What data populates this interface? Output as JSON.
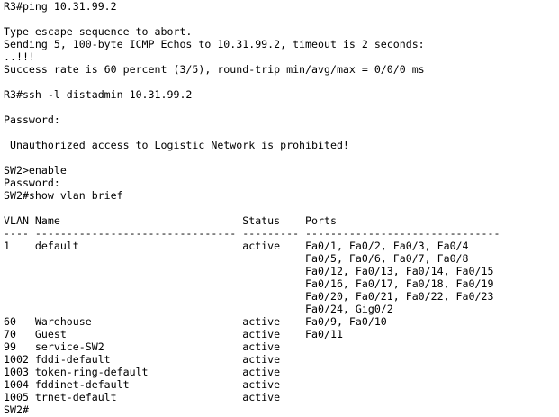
{
  "terminal": {
    "lines": [
      "R3#ping 10.31.99.2",
      "",
      "Type escape sequence to abort.",
      "Sending 5, 100-byte ICMP Echos to 10.31.99.2, timeout is 2 seconds:",
      "..!!!",
      "Success rate is 60 percent (3/5), round-trip min/avg/max = 0/0/0 ms",
      "",
      "R3#ssh -l distadmin 10.31.99.2",
      "",
      "Password:",
      "",
      " Unauthorized access to Logistic Network is prohibited!",
      "",
      "SW2>enable",
      "Password:",
      "SW2#show vlan brief",
      "",
      "VLAN Name                             Status    Ports",
      "---- -------------------------------- --------- -------------------------------",
      "1    default                          active    Fa0/1, Fa0/2, Fa0/3, Fa0/4",
      "                                                Fa0/5, Fa0/6, Fa0/7, Fa0/8",
      "                                                Fa0/12, Fa0/13, Fa0/14, Fa0/15",
      "                                                Fa0/16, Fa0/17, Fa0/18, Fa0/19",
      "                                                Fa0/20, Fa0/21, Fa0/22, Fa0/23",
      "                                                Fa0/24, Gig0/2",
      "60   Warehouse                        active    Fa0/9, Fa0/10",
      "70   Guest                            active    Fa0/11",
      "99   service-SW2                      active",
      "1002 fddi-default                     active",
      "1003 token-ring-default               active",
      "1004 fddinet-default                  active",
      "1005 trnet-default                    active",
      "SW2#"
    ]
  }
}
